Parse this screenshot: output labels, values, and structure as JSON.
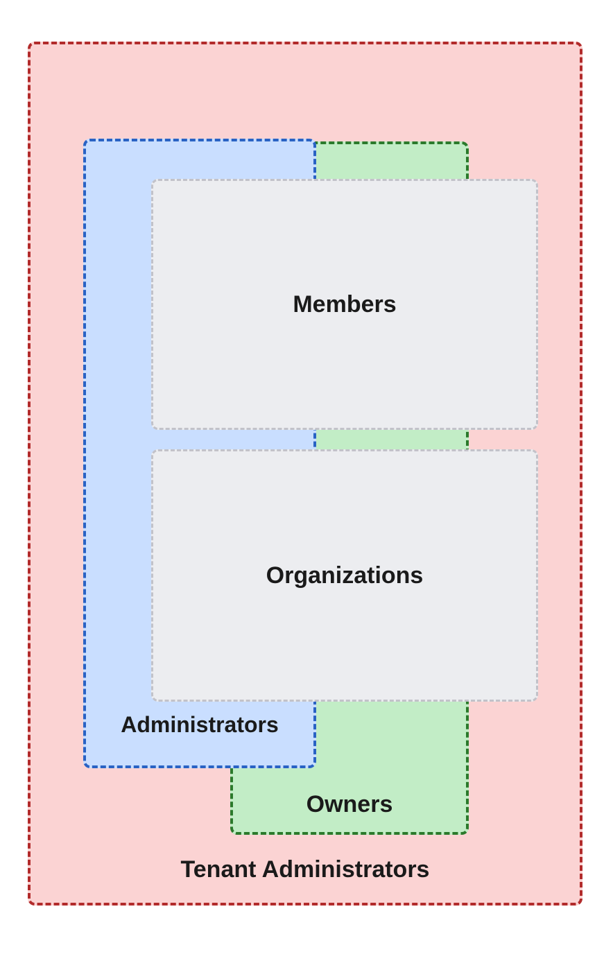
{
  "tenant_admins": {
    "label": "Tenant Administrators"
  },
  "owners": {
    "label": "Owners"
  },
  "administrators": {
    "label": "Administrators"
  },
  "members": {
    "label": "Members"
  },
  "organizations": {
    "label": "Organizations"
  },
  "colors": {
    "tenant_admin_fill": "#fbd3d3",
    "tenant_admin_border": "#b22b2b",
    "owners_fill": "#c2edc6",
    "owners_border": "#2b7a2b",
    "administrators_fill": "#c9deff",
    "administrators_border": "#2962c4",
    "inner_fill": "#ecedf0",
    "inner_border": "#c2c2c9"
  }
}
